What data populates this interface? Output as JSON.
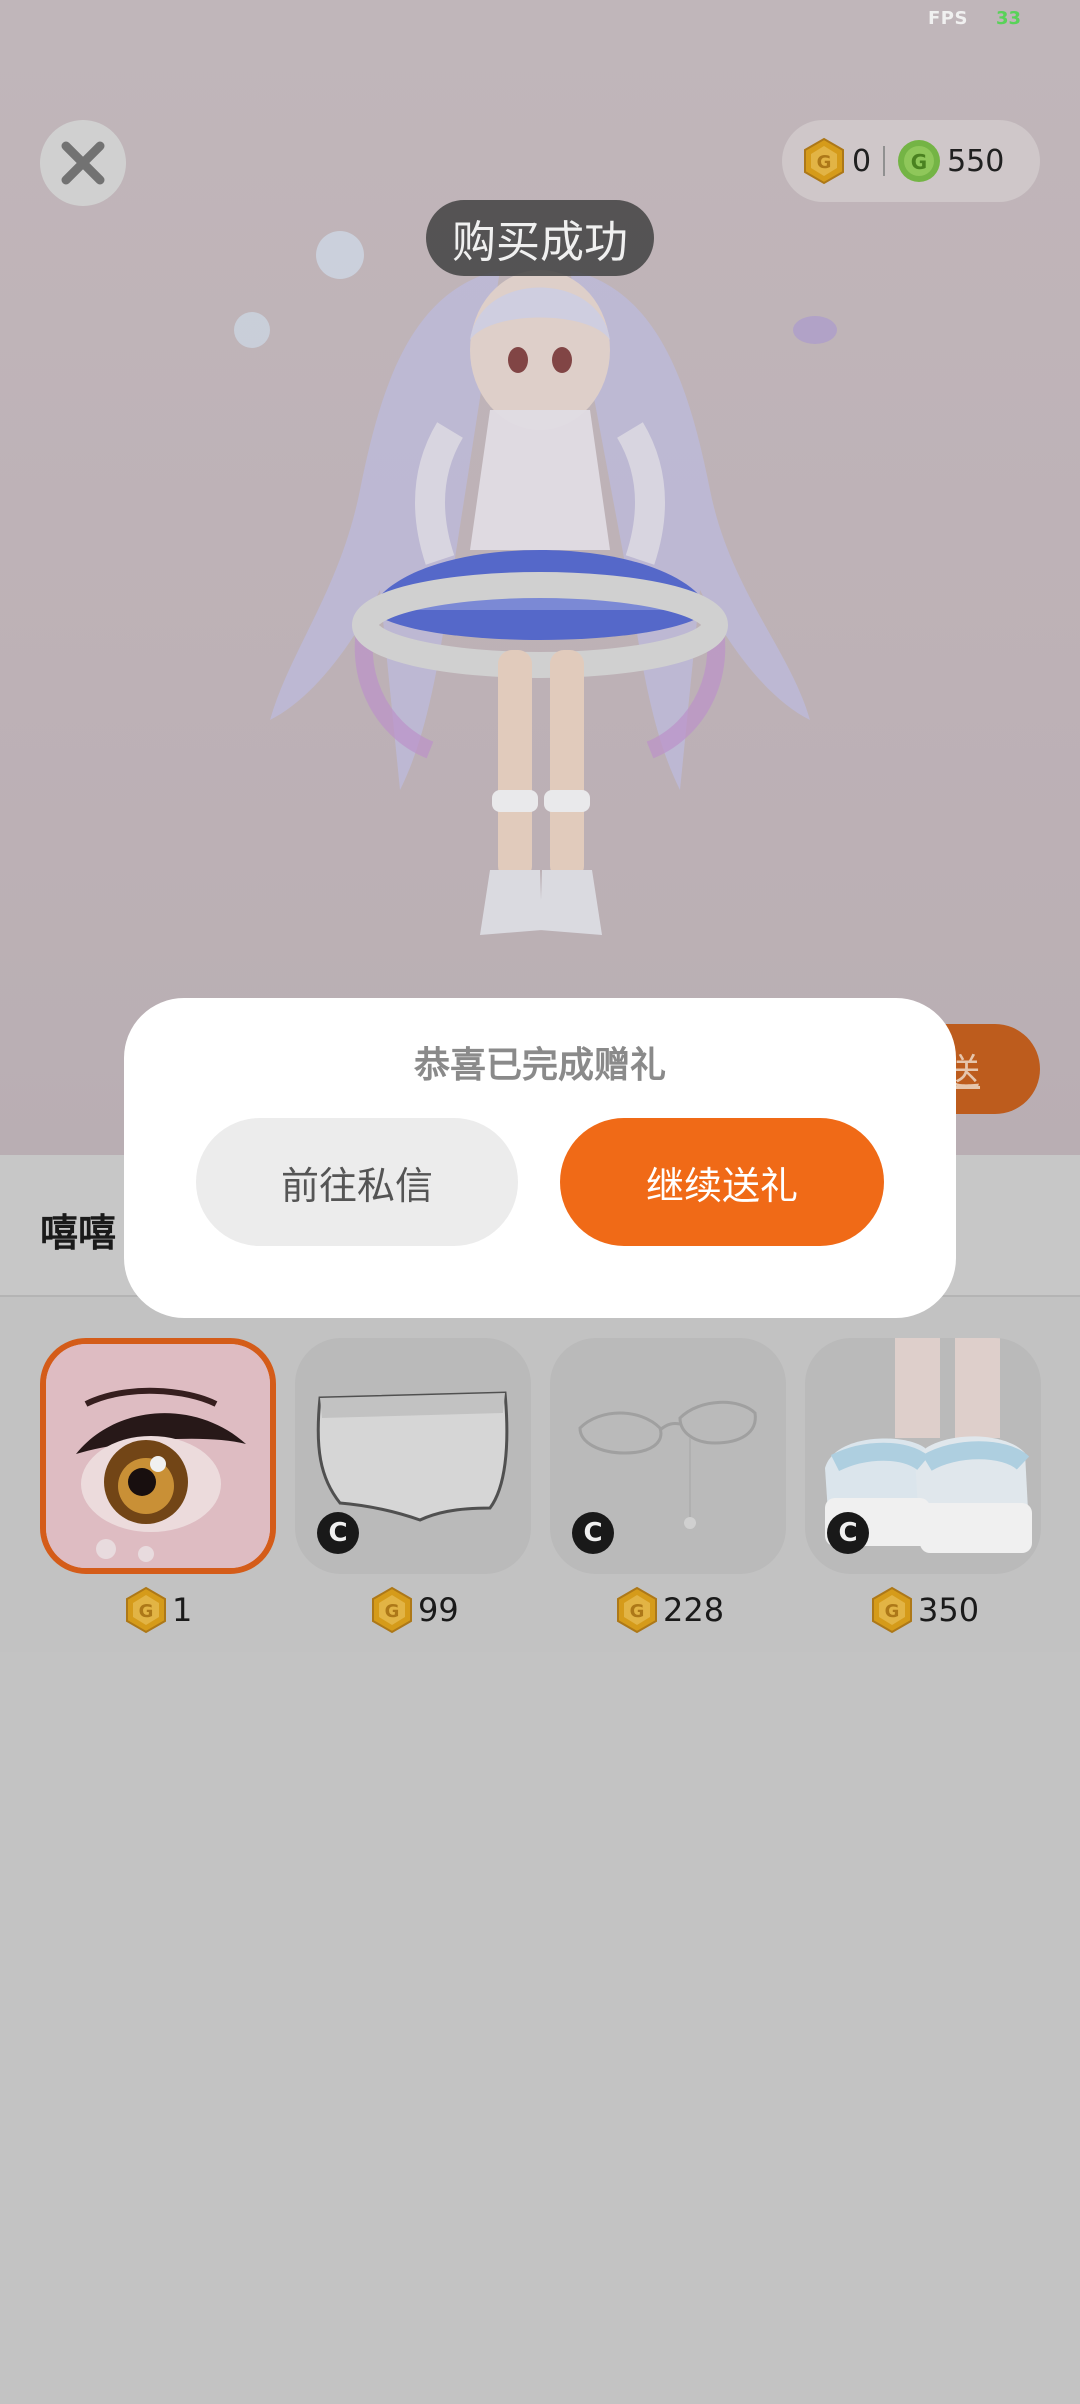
{
  "status": {
    "fps_label": "FPS",
    "fps_value": "33"
  },
  "wallet": {
    "gold_amount": "0",
    "green_amount": "550"
  },
  "toast": {
    "text": "购买成功"
  },
  "stage": {
    "partial_button_label": "送"
  },
  "panel": {
    "recipient_name": "嘻嘻"
  },
  "items": [
    {
      "name": "eye-item",
      "price": "1",
      "selected": true,
      "currency_badge": ""
    },
    {
      "name": "briefs-item",
      "price": "99",
      "selected": false,
      "currency_badge": "C"
    },
    {
      "name": "glasses-item",
      "price": "228",
      "selected": false,
      "currency_badge": "C"
    },
    {
      "name": "shoes-item",
      "price": "350",
      "selected": false,
      "currency_badge": "C"
    }
  ],
  "dialog": {
    "title": "恭喜已完成赠礼",
    "dm_button": "前往私信",
    "continue_button": "继续送礼"
  },
  "colors": {
    "accent": "#f06a17",
    "coin_gold": "#e3a51c",
    "coin_green": "#7cc04a"
  }
}
